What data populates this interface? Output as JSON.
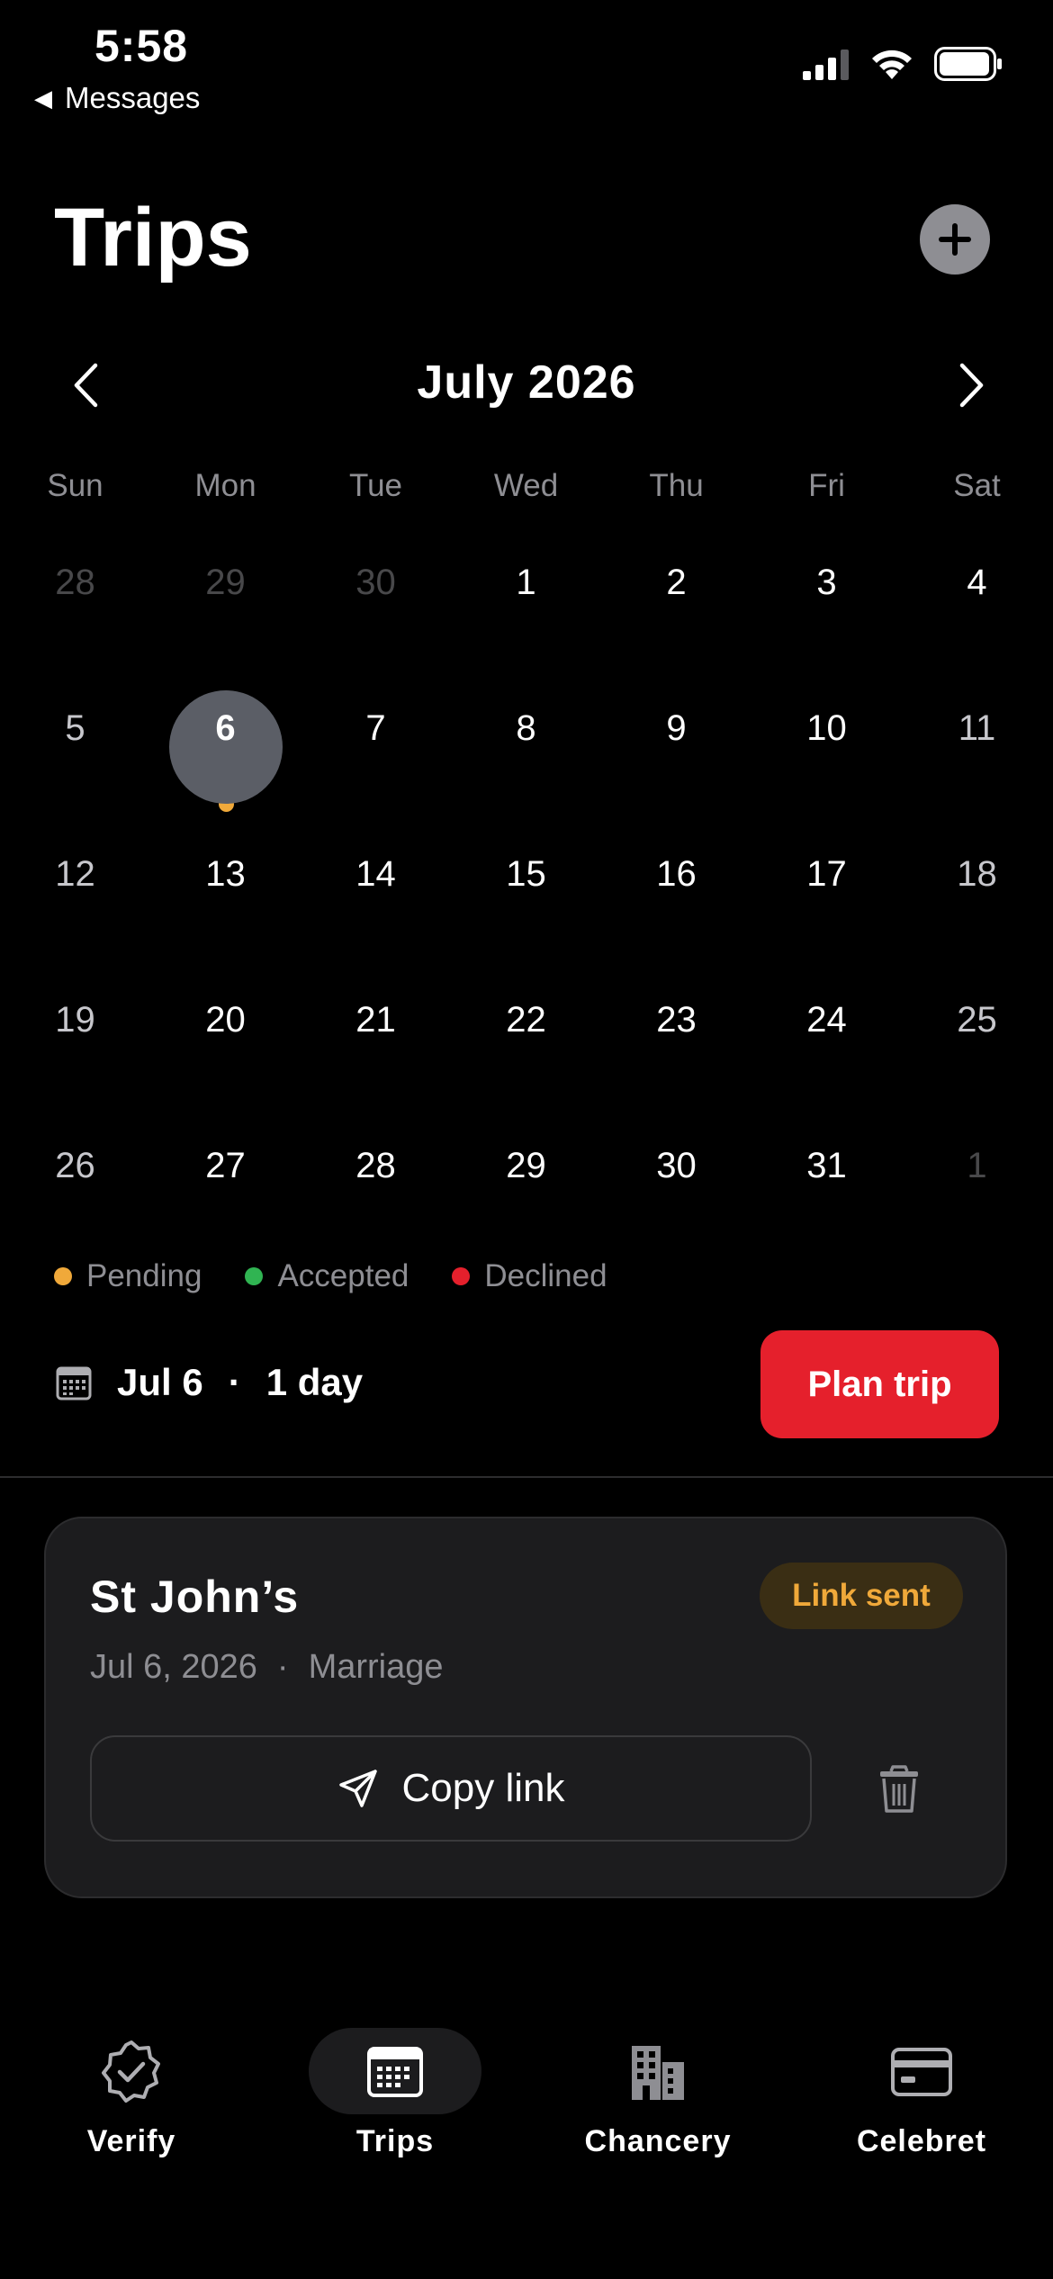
{
  "status_bar": {
    "time": "5:58",
    "back_label": "Messages"
  },
  "header": {
    "title": "Trips"
  },
  "calendar": {
    "month_label": "July 2026",
    "weekdays": [
      "Sun",
      "Mon",
      "Tue",
      "Wed",
      "Thu",
      "Fri",
      "Sat"
    ],
    "weeks": [
      [
        "28",
        "29",
        "30",
        "1",
        "2",
        "3",
        "4"
      ],
      [
        "5",
        "6",
        "7",
        "8",
        "9",
        "10",
        "11"
      ],
      [
        "12",
        "13",
        "14",
        "15",
        "16",
        "17",
        "18"
      ],
      [
        "19",
        "20",
        "21",
        "22",
        "23",
        "24",
        "25"
      ],
      [
        "26",
        "27",
        "28",
        "29",
        "30",
        "31",
        "1"
      ]
    ],
    "selected_day": "6"
  },
  "legend": [
    {
      "label": "Pending",
      "color": "#f0a93a"
    },
    {
      "label": "Accepted",
      "color": "#30b452"
    },
    {
      "label": "Declined",
      "color": "#e5202c"
    }
  ],
  "selection": {
    "date": "Jul 6",
    "separator": "·",
    "duration": "1 day",
    "plan_label": "Plan trip"
  },
  "trip_card": {
    "title": "St John’s",
    "status_badge": "Link sent",
    "date": "Jul 6, 2026",
    "separator": "·",
    "type": "Marriage",
    "copy_label": "Copy link"
  },
  "tabs": [
    {
      "label": "Verify",
      "icon": "badge-check-icon"
    },
    {
      "label": "Trips",
      "icon": "calendar-icon",
      "active": true
    },
    {
      "label": "Chancery",
      "icon": "building-icon"
    },
    {
      "label": "Celebret",
      "icon": "card-icon"
    }
  ],
  "colors": {
    "accent": "#e5202c",
    "pending": "#f0a93a",
    "accepted": "#30b452",
    "declined": "#e5202c"
  }
}
